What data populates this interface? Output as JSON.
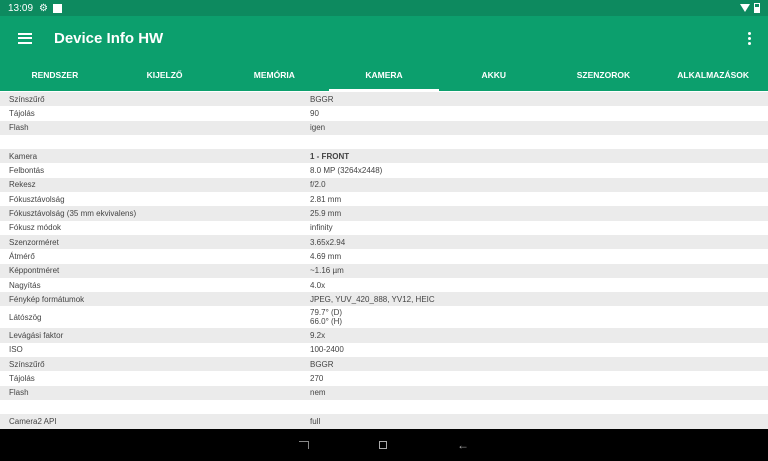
{
  "status": {
    "time": "13:09"
  },
  "app": {
    "title": "Device Info HW"
  },
  "tabs": [
    "RENDSZER",
    "KIJELZŐ",
    "MEMÓRIA",
    "KAMERA",
    "AKKU",
    "SZENZOROK",
    "ALKALMAZÁSOK"
  ],
  "active_tab": "KAMERA",
  "rows": [
    {
      "k": "Színszűrő",
      "v": "BGGR"
    },
    {
      "k": "Tájolás",
      "v": "90"
    },
    {
      "k": "Flash",
      "v": "igen"
    },
    {
      "k": "",
      "v": ""
    },
    {
      "k": "Kamera",
      "v": "1 - FRONT",
      "bold": true
    },
    {
      "k": "Felbontás",
      "v": "8.0 MP (3264x2448)"
    },
    {
      "k": "Rekesz",
      "v": "f/2.0"
    },
    {
      "k": "Fókusztávolság",
      "v": "2.81 mm"
    },
    {
      "k": "Fókusztávolság (35 mm ekvivalens)",
      "v": "25.9 mm"
    },
    {
      "k": "Fókusz módok",
      "v": "infinity"
    },
    {
      "k": "Szenzorméret",
      "v": "3.65x2.94"
    },
    {
      "k": "Átmérő",
      "v": "4.69 mm"
    },
    {
      "k": "Képpontméret",
      "v": "~1.16 µm"
    },
    {
      "k": "Nagyítás",
      "v": "4.0x"
    },
    {
      "k": "Fénykép formátumok",
      "v": "JPEG, YUV_420_888, YV12, HEIC"
    },
    {
      "k": "Látószög",
      "v": "79.7° (D)",
      "v2": "66.0° (H)"
    },
    {
      "k": "Levágási faktor",
      "v": "9.2x"
    },
    {
      "k": "ISO",
      "v": "100-2400"
    },
    {
      "k": "Színszűrő",
      "v": "BGGR"
    },
    {
      "k": "Tájolás",
      "v": "270"
    },
    {
      "k": "Flash",
      "v": "nem"
    },
    {
      "k": "",
      "v": ""
    },
    {
      "k": "Camera2 API",
      "v": "full"
    }
  ]
}
